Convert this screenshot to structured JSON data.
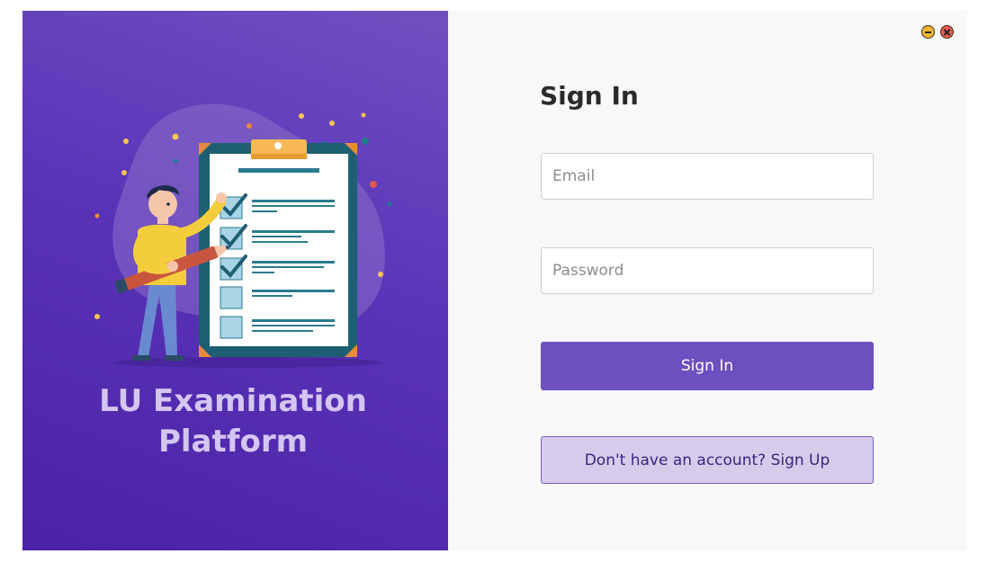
{
  "app": {
    "brand_line1": "LU Examination",
    "brand_line2": "Platform"
  },
  "window_controls": {
    "minimize_icon": "minimize-icon",
    "close_icon": "close-icon",
    "minimize_color": "#f2b632",
    "close_color": "#ee5a52"
  },
  "form": {
    "title": "Sign In",
    "email_placeholder": "Email",
    "email_value": "",
    "password_placeholder": "Password",
    "password_value": "",
    "sign_in_label": "Sign In",
    "sign_up_label": "Don't have an account? Sign Up"
  },
  "colors": {
    "accent": "#6e4fbf",
    "panel_gradient_top": "#7150c0",
    "panel_gradient_bottom": "#4a22a6",
    "secondary_bg": "#d6cbeb",
    "brand_text": "#d4c6f2"
  },
  "illustration": {
    "icon": "exam-checklist-illustration",
    "checked_items": 3,
    "total_items": 5
  }
}
